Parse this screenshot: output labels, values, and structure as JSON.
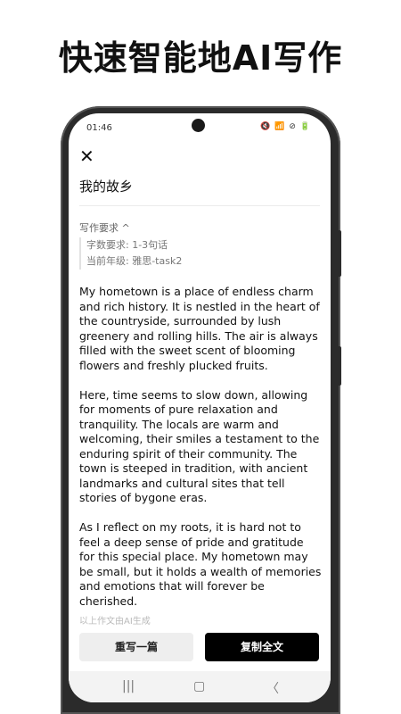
{
  "headline": "快速智能地AI写作",
  "status": {
    "time": "01:46",
    "icons": "🔇 📶 ⊘ 🔋"
  },
  "close_icon": "✕",
  "doc_title": "我的故乡",
  "requirements": {
    "toggle_label": "写作要求 ^",
    "word_count": "字数要求: 1-3句话",
    "grade": "当前年级: 雅思-task2"
  },
  "essay": {
    "p1": "My hometown is a place of endless charm and rich history. It is nestled in the heart of the countryside, surrounded by lush greenery and rolling hills. The air is always filled with the sweet scent of blooming flowers and freshly plucked fruits.",
    "p2": "Here, time seems to slow down, allowing for moments of pure relaxation and tranquility. The locals are warm and welcoming, their smiles a testament to the enduring spirit of their community. The town is steeped in tradition, with ancient landmarks and cultural sites that tell stories of bygone eras.",
    "p3": "As I reflect on my roots, it is hard not to feel a deep sense of pride and gratitude for this special place. My hometown may be small, but it holds a wealth of memories and emotions that will forever be cherished."
  },
  "ai_note": "以上作文由AI生成",
  "buttons": {
    "rewrite": "重写一篇",
    "copy": "复制全文"
  },
  "nav": {
    "recent": "|||",
    "home": "▢",
    "back": "〈"
  }
}
